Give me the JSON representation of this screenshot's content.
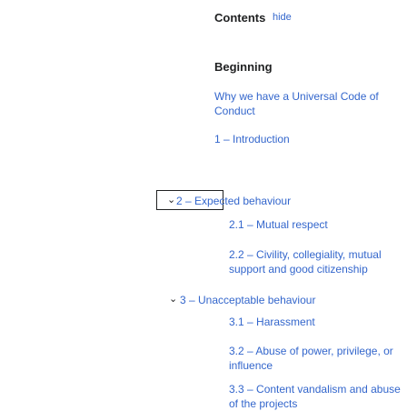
{
  "toc": {
    "title": "Contents",
    "hide_label": "hide",
    "beginning": "Beginning",
    "items": [
      {
        "text": "Why we have a Universal Code of Conduct",
        "level": 1
      },
      {
        "text": "1 – Introduction",
        "level": 1
      },
      {
        "text": "2 – Expected behaviour",
        "level": 1,
        "expanded": true
      },
      {
        "text": "2.1 – Mutual respect",
        "level": 2
      },
      {
        "text": "2.2 – Civility, collegiality, mutual support and good citizenship",
        "level": 2
      },
      {
        "text": "3 – Unacceptable behaviour",
        "level": 1,
        "expanded": true
      },
      {
        "text": "3.1 – Harassment",
        "level": 2
      },
      {
        "text": "3.2 – Abuse of power, privilege, or influence",
        "level": 2
      },
      {
        "text": "3.3 – Content vandalism and abuse of the projects",
        "level": 2
      }
    ]
  },
  "icons": {
    "expand": "chevron-down-icon"
  }
}
